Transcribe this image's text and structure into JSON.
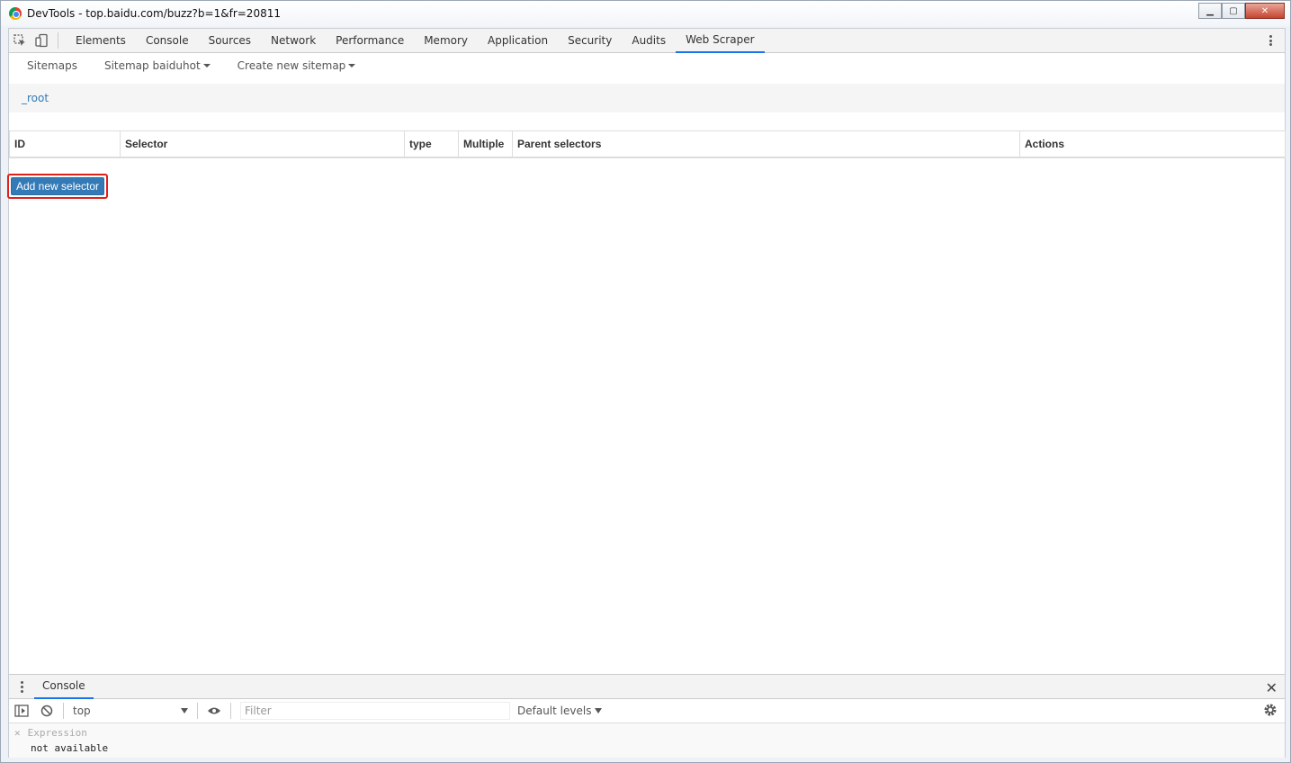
{
  "window": {
    "title": "DevTools - top.baidu.com/buzz?b=1&fr=20811",
    "controls": {
      "minimize": "▁",
      "maximize": "▢",
      "close": "✕"
    }
  },
  "devtools": {
    "tabs": [
      "Elements",
      "Console",
      "Sources",
      "Network",
      "Performance",
      "Memory",
      "Application",
      "Security",
      "Audits",
      "Web Scraper"
    ],
    "active_tab": "Web Scraper"
  },
  "scraper": {
    "nav": {
      "sitemaps": "Sitemaps",
      "sitemap_menu": "Sitemap baiduhot",
      "create_menu": "Create new sitemap"
    },
    "breadcrumb": "_root",
    "table_headers": [
      "ID",
      "Selector",
      "type",
      "Multiple",
      "Parent selectors",
      "Actions"
    ],
    "add_button": "Add new selector"
  },
  "drawer": {
    "tab": "Console",
    "context": "top",
    "filter_placeholder": "Filter",
    "levels": "Default levels",
    "watch_label": "Expression",
    "watch_value": "not available"
  },
  "colors": {
    "accent": "#1a73e8",
    "primary_button": "#337ab7",
    "highlight_box": "#e0201a",
    "link": "#337ab7"
  }
}
